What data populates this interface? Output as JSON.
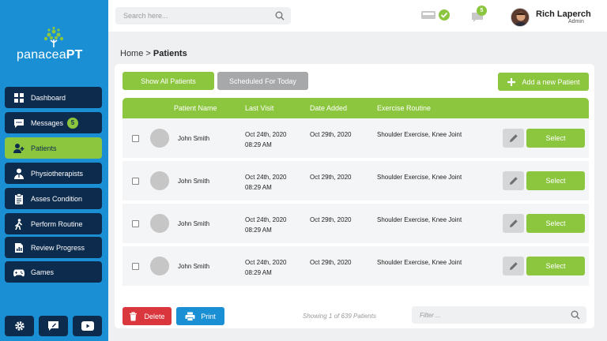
{
  "app": {
    "logo_prefix": "panacea",
    "logo_suffix": "PT"
  },
  "sidebar": {
    "items": [
      {
        "label": "Dashboard",
        "icon": "dashboard-icon"
      },
      {
        "label": "Messages",
        "icon": "messages-icon",
        "badge": "5"
      },
      {
        "label": "Patients",
        "icon": "patients-icon",
        "active": true
      },
      {
        "label": "Physiotherapists",
        "icon": "physiotherapist-icon"
      },
      {
        "label": "Asses Condition",
        "icon": "clipboard-icon"
      },
      {
        "label": "Perform Routine",
        "icon": "walking-icon"
      },
      {
        "label": "Review Progress",
        "icon": "report-icon"
      },
      {
        "label": "Games",
        "icon": "gamepad-icon"
      }
    ],
    "bottom": [
      "settings-icon",
      "feedback-icon",
      "video-icon"
    ]
  },
  "topbar": {
    "search_placeholder": "Search here...",
    "chat_badge": "5",
    "user_name": "Rich Laperch",
    "user_role": "Admin"
  },
  "breadcrumb": {
    "home": "Home",
    "separator": ">",
    "current": "Patients"
  },
  "toolbar": {
    "show_all": "Show All Patients",
    "scheduled": "Scheduled For Today",
    "add_new": "Add a new Patient"
  },
  "table": {
    "headers": [
      "Patient Name",
      "Last Visit",
      "Date Added",
      "Exercise Routine"
    ],
    "rows": [
      {
        "name": "John Smith",
        "last_visit_date": "Oct 24th, 2020",
        "last_visit_time": "08:29 AM",
        "date_added": "Oct 29th, 2020",
        "routine": "Shoulder Exercise, Knee Joint",
        "action": "Select"
      },
      {
        "name": "John Smith",
        "last_visit_date": "Oct 24th, 2020",
        "last_visit_time": "08:29 AM",
        "date_added": "Oct 29th, 2020",
        "routine": "Shoulder Exercise, Knee Joint",
        "action": "Select"
      },
      {
        "name": "John Smith",
        "last_visit_date": "Oct 24th, 2020",
        "last_visit_time": "08:29 AM",
        "date_added": "Oct 29th, 2020",
        "routine": "Shoulder Exercise, Knee Joint",
        "action": "Select"
      },
      {
        "name": "John Smith",
        "last_visit_date": "Oct 24th, 2020",
        "last_visit_time": "08:29 AM",
        "date_added": "Oct 29th, 2020",
        "routine": "Shoulder Exercise, Knee Joint",
        "action": "Select"
      }
    ]
  },
  "footer": {
    "delete": "Delete",
    "print": "Print",
    "showing": "Showing 1 of 639 Patients",
    "filter_placeholder": "Filter ..."
  },
  "colors": {
    "sidebar": "#1b8fd3",
    "nav": "#0d2b4d",
    "accent": "#8cc63f",
    "delete": "#d9363e",
    "print": "#1b8fd3",
    "muted_button": "#a6a8aa"
  }
}
